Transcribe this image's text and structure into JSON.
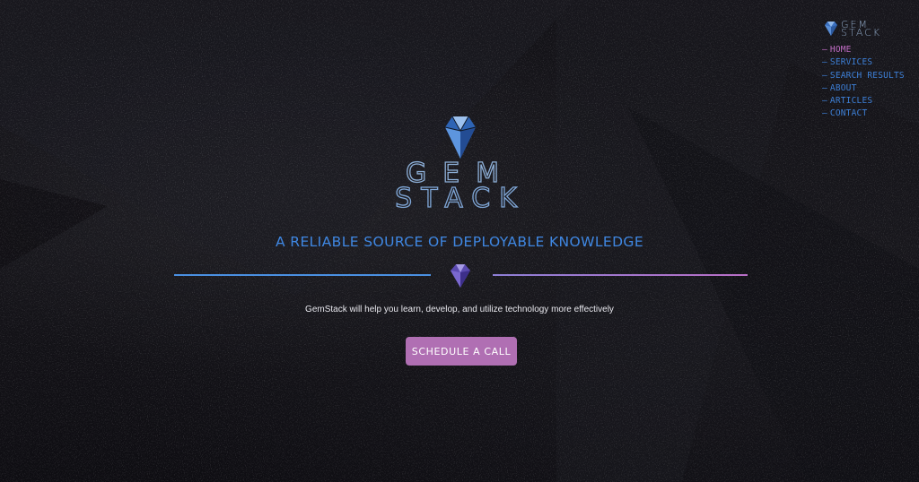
{
  "brand": {
    "nav_logo_line1": "GEM",
    "nav_logo_line2": "STACK",
    "hero_logo_line1": "GEM",
    "hero_logo_line2": "STACK"
  },
  "nav": {
    "items": [
      {
        "label": "HOME",
        "active": true
      },
      {
        "label": "SERVICES",
        "active": false
      },
      {
        "label": "SEARCH RESULTS",
        "active": false
      },
      {
        "label": "ABOUT",
        "active": false
      },
      {
        "label": "ARTICLES",
        "active": false
      },
      {
        "label": "CONTACT",
        "active": false
      }
    ],
    "dash": "—"
  },
  "hero": {
    "tagline": "A RELIABLE SOURCE OF DEPLOYABLE KNOWLEDGE",
    "subtext": "GemStack will help you learn, develop, and utilize technology more effectively",
    "cta_label": "SCHEDULE A CALL"
  },
  "colors": {
    "accent_blue": "#3f87e2",
    "accent_purple": "#b06fb3",
    "active_nav": "#c06cc4",
    "nav_link": "#3d7fd6"
  },
  "icons": {
    "hero_logo": "gem-icon",
    "divider_icon": "gem-icon",
    "nav_logo": "gem-icon"
  }
}
